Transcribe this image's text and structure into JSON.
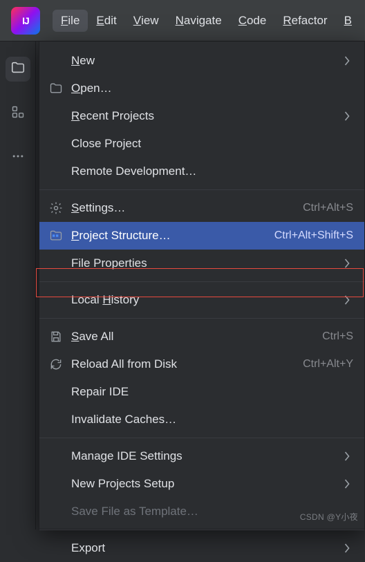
{
  "menubar": {
    "items": [
      {
        "label": "File",
        "mnemonic": "F",
        "active": true
      },
      {
        "label": "Edit",
        "mnemonic": "E"
      },
      {
        "label": "View",
        "mnemonic": "V"
      },
      {
        "label": "Navigate",
        "mnemonic": "N"
      },
      {
        "label": "Code",
        "mnemonic": "C"
      },
      {
        "label": "Refactor",
        "mnemonic": "R"
      },
      {
        "label": "B",
        "mnemonic": "B",
        "partial": true
      }
    ]
  },
  "left_toolbar": {
    "items": [
      {
        "name": "project-tool",
        "icon": "folder-icon",
        "active": true
      },
      {
        "name": "structure-tool",
        "icon": "structure-icon"
      },
      {
        "name": "more-tool",
        "icon": "more-icon"
      }
    ]
  },
  "dropdown": {
    "items": [
      {
        "label": "New",
        "mnemonic": "N",
        "icon": "",
        "submenu": true
      },
      {
        "label": "Open…",
        "mnemonic": "O",
        "icon": "folder-icon"
      },
      {
        "label": "Recent Projects",
        "mnemonic": "R",
        "submenu": true
      },
      {
        "label": "Close Project"
      },
      {
        "label": "Remote Development…"
      },
      {
        "sep": true
      },
      {
        "label": "Settings…",
        "mnemonic": "S",
        "icon": "gear-icon",
        "shortcut": "Ctrl+Alt+S"
      },
      {
        "label": "Project Structure…",
        "mnemonic": "P",
        "icon": "project-structure-icon",
        "shortcut": "Ctrl+Alt+Shift+S",
        "highlighted": true
      },
      {
        "label": "File Properties",
        "submenu": true
      },
      {
        "sep": true
      },
      {
        "label": "Local History",
        "mnemonic": "H",
        "submenu": true
      },
      {
        "sep": true
      },
      {
        "label": "Save All",
        "mnemonic": "S",
        "icon": "save-icon",
        "shortcut": "Ctrl+S"
      },
      {
        "label": "Reload All from Disk",
        "icon": "reload-icon",
        "shortcut": "Ctrl+Alt+Y"
      },
      {
        "label": "Repair IDE"
      },
      {
        "label": "Invalidate Caches…"
      },
      {
        "sep": true
      },
      {
        "label": "Manage IDE Settings",
        "submenu": true
      },
      {
        "label": "New Projects Setup",
        "submenu": true
      },
      {
        "label": "Save File as Template…",
        "disabled": true
      },
      {
        "sep": true
      },
      {
        "label": "Export",
        "submenu": true
      }
    ]
  },
  "watermark": "CSDN @Y小夜"
}
